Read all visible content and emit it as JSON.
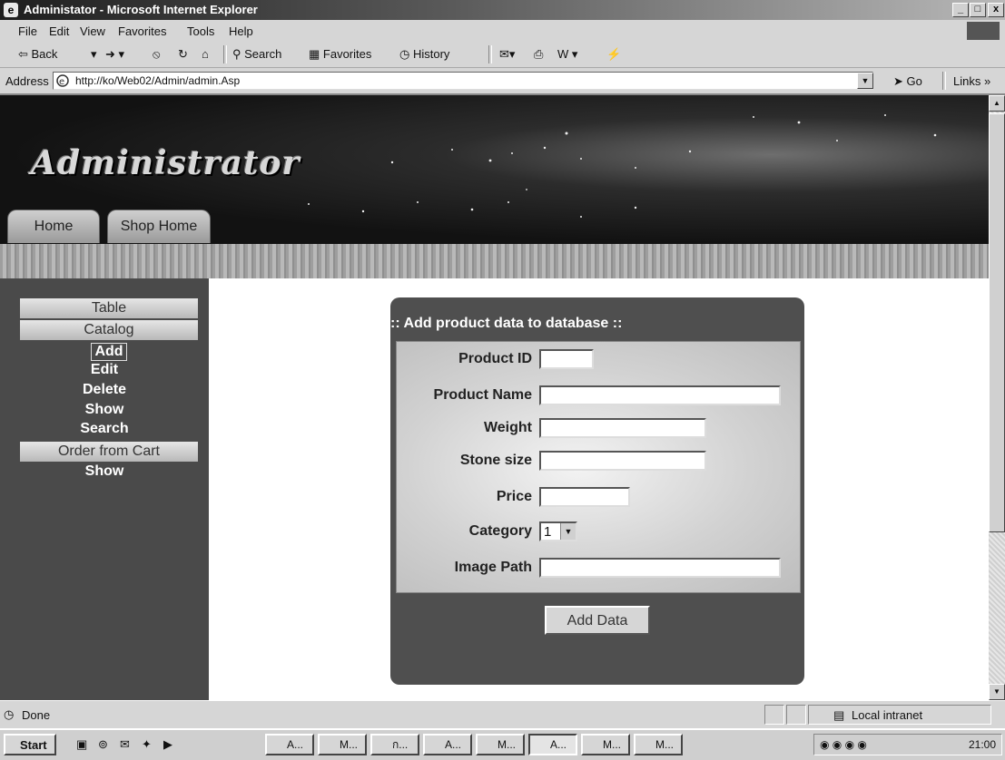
{
  "window": {
    "title": "Administator - Microsoft Internet Explorer",
    "controls": [
      "_",
      "̵",
      "x"
    ]
  },
  "menu": [
    "File",
    "Edit",
    "View",
    "Favorites",
    "Tools",
    "Help"
  ],
  "toolbar": {
    "back": "⇦ Back",
    "search": "Search",
    "favorites": "Favorites",
    "history": "History"
  },
  "address": {
    "label": "Address",
    "url": "http://ko/Web02/Admin/admin.Asp",
    "go": "Go",
    "links": "Links »"
  },
  "page": {
    "banner_title": "Administrator",
    "tabs": [
      "Home",
      "Shop Home"
    ],
    "sidebar": {
      "heading_table": "Table",
      "heading_catalog": "Catalog",
      "catalog_items": [
        "Add",
        "Edit",
        "Delete",
        "Show",
        "Search"
      ],
      "heading_order": "Order from Cart",
      "order_items": [
        "Show"
      ]
    },
    "form": {
      "heading": ":: Add product data to database ::",
      "fields": [
        {
          "label": "Product ID",
          "value": ""
        },
        {
          "label": "Product Name",
          "value": ""
        },
        {
          "label": "Weight",
          "value": ""
        },
        {
          "label": "Stone size",
          "value": ""
        },
        {
          "label": "Price",
          "value": ""
        },
        {
          "label": "Category",
          "value": "1"
        },
        {
          "label": "Image Path",
          "value": ""
        }
      ],
      "submit_label": "Add Data"
    }
  },
  "status": {
    "text": "Done",
    "zone": "Local intranet"
  },
  "taskbar": {
    "start": "Start",
    "buttons": [
      "A...",
      "M...",
      "ก...",
      "A...",
      "M...",
      "A...",
      "M...",
      "M..."
    ],
    "active_index": 5,
    "clock": "21:00"
  },
  "colors": {
    "sidebar_bg": "#4a4a4a",
    "form_bg": "#4f4f4f",
    "banner_bg": "#121212"
  }
}
